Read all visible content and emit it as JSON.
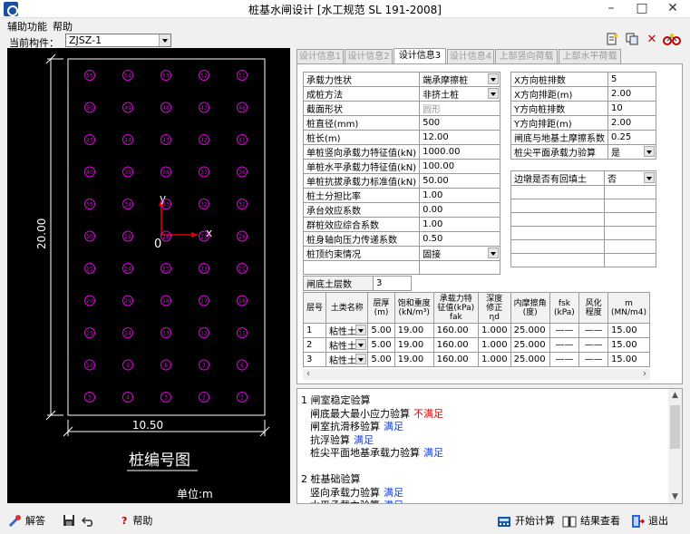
{
  "window": {
    "title": "桩基水闸设计 [水工规范 SL 191-2008]"
  },
  "menu": [
    "辅助功能",
    "帮助"
  ],
  "component": {
    "label": "当前构件：",
    "value": "ZJSZ-1"
  },
  "tabs": [
    "设计信息1",
    "设计信息2",
    "设计信息3",
    "设计信息4",
    "上部竖向荷载",
    "上部水平荷载"
  ],
  "active_tab": 2,
  "drawing": {
    "dim_vertical": "20.00",
    "dim_horizontal": "10.50",
    "title": "桩编号图",
    "unit": "单位:m",
    "axis_y": "y",
    "axis_x": "x",
    "origin": "0",
    "pile_rows": 11,
    "pile_cols": 5,
    "pile_color": "#e000e0"
  },
  "params": [
    {
      "label": "承载力性状",
      "value": "端承摩擦桩",
      "dropdown": true
    },
    {
      "label": "成桩方法",
      "value": "非挤土桩",
      "dropdown": true
    },
    {
      "label": "截面形状",
      "value": "圆形",
      "disabled": true
    },
    {
      "label": "桩直径(mm)",
      "value": "500"
    },
    {
      "label": "桩长(m)",
      "value": "12.00"
    },
    {
      "label": "单桩竖向承载力特征值(kN)",
      "value": "1000.00"
    },
    {
      "label": "单桩水平承载力特征值(kN)",
      "value": "100.00"
    },
    {
      "label": "单桩抗拔承载力标准值(kN)",
      "value": "50.00"
    },
    {
      "label": "桩土分担比率",
      "value": "1.00"
    },
    {
      "label": "承台效应系数",
      "value": "0.00"
    },
    {
      "label": "群桩效应综合系数",
      "value": "1.00"
    },
    {
      "label": "桩身轴向压力传递系数",
      "value": "0.50"
    },
    {
      "label": "桩顶约束情况",
      "value": "固接",
      "dropdown": true
    }
  ],
  "right_params": [
    {
      "label": "X方向桩排数",
      "value": "5"
    },
    {
      "label": "X方向排距(m)",
      "value": "2.00"
    },
    {
      "label": "Y方向桩排数",
      "value": "10"
    },
    {
      "label": "Y方向排距(m)",
      "value": "2.00"
    },
    {
      "label": "闸底与地基土摩擦系数",
      "value": "0.25"
    },
    {
      "label": "桩尖平面承载力验算",
      "value": "是",
      "dropdown": true
    }
  ],
  "backfill": {
    "label": "边墩是否有回填土",
    "value": "否"
  },
  "soil": {
    "layers_label": "闸底土层数",
    "layers_value": "3",
    "headers": [
      [
        "层号"
      ],
      [
        "土类名称"
      ],
      [
        "层厚",
        "(m)"
      ],
      [
        "饱和重度",
        "(kN/m³)"
      ],
      [
        "承载力特",
        "征值(kPa)",
        "fak"
      ],
      [
        "深度",
        "修正",
        "ηd"
      ],
      [
        "内摩擦角",
        "(度)"
      ],
      [
        "fsk",
        "(kPa)"
      ],
      [
        "风化",
        "程度"
      ],
      [
        "m",
        "(MN/m4)"
      ]
    ],
    "rows": [
      [
        "1",
        "粘性土",
        "5.00",
        "19.00",
        "160.00",
        "1.000",
        "25.000",
        "——",
        "——",
        "15.00"
      ],
      [
        "2",
        "粘性土",
        "5.00",
        "19.00",
        "160.00",
        "1.000",
        "25.000",
        "——",
        "——",
        "15.00"
      ],
      [
        "3",
        "粘性土",
        "5.00",
        "19.00",
        "160.00",
        "1.000",
        "25.000",
        "——",
        "——",
        "15.00"
      ]
    ]
  },
  "results": {
    "lines": [
      {
        "indent": 0,
        "text": "1 闸室稳定验算",
        "status": "",
        "status_color": ""
      },
      {
        "indent": 1,
        "text": "闸底最大最小应力验算",
        "status": "不满足",
        "status_color": "red"
      },
      {
        "indent": 1,
        "text": "闸室抗滑移验算",
        "status": "满足",
        "status_color": "blue"
      },
      {
        "indent": 1,
        "text": "抗浮验算",
        "status": "满足",
        "status_color": "blue"
      },
      {
        "indent": 1,
        "text": "桩尖平面地基承载力验算",
        "status": "满足",
        "status_color": "blue"
      },
      {
        "indent": 0,
        "text": "",
        "status": "",
        "status_color": ""
      },
      {
        "indent": 0,
        "text": "2 桩基础验算",
        "status": "",
        "status_color": ""
      },
      {
        "indent": 1,
        "text": "竖向承载力验算",
        "status": "满足",
        "status_color": "blue"
      },
      {
        "indent": 1,
        "text": "水平承载力验算",
        "status": "满足",
        "status_color": "blue"
      }
    ]
  },
  "bottom": {
    "help_answer": "解答",
    "help": "帮助",
    "start_calc": "开始计算",
    "view_results": "结果查看",
    "exit": "退出"
  }
}
